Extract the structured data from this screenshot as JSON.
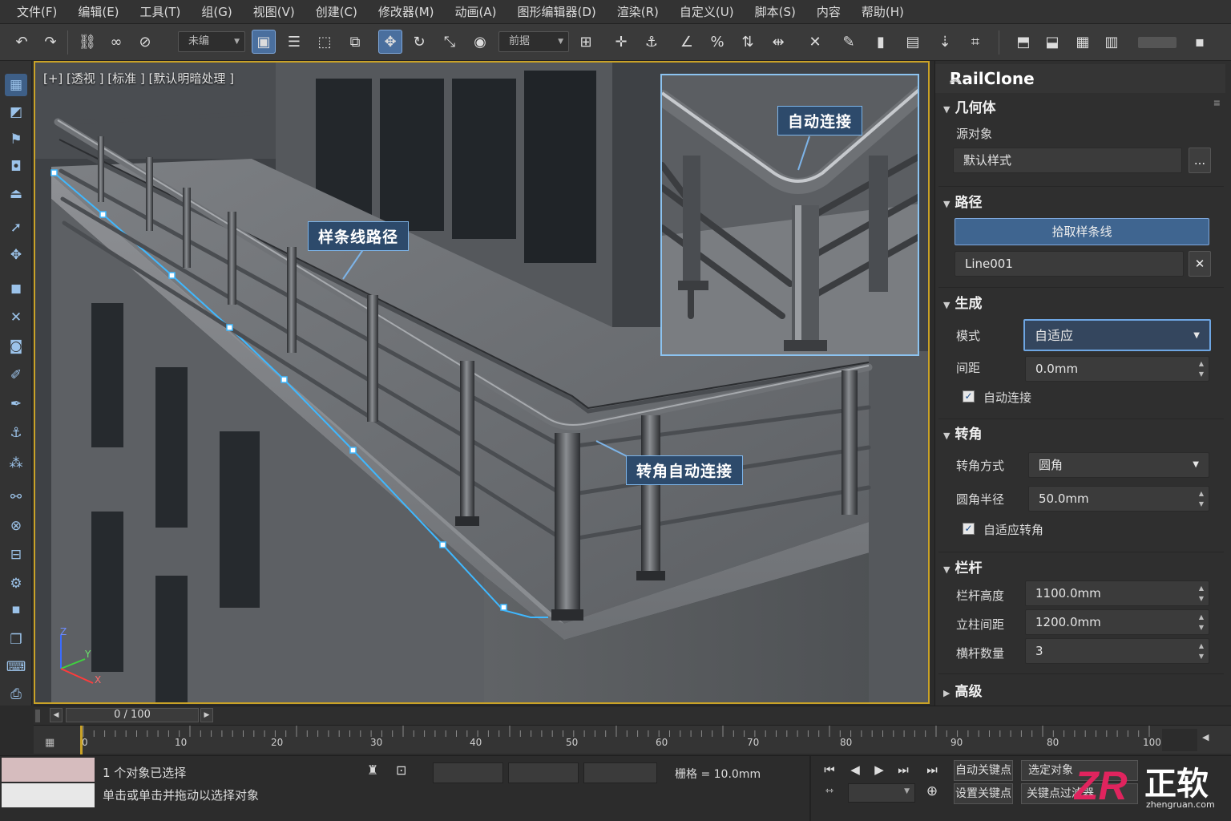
{
  "menu": [
    "文件(F)",
    "编辑(E)",
    "工具(T)",
    "组(G)",
    "视图(V)",
    "创建(C)",
    "修改器(M)",
    "动画(A)",
    "图形编辑器(D)",
    "渲染(R)",
    "自定义(U)",
    "脚本(S)",
    "内容",
    "帮助(H)"
  ],
  "toolbar": {
    "selection_set": "未编",
    "named_set": "前据"
  },
  "viewport": {
    "label": "[+] [透视 ] [标准 ] [默认明暗处理 ]",
    "callout_spline": "样条线路径",
    "callout_corner": "转角自动连接",
    "callout_auto": "自动连接",
    "axis_x": "X",
    "axis_y": "Y",
    "axis_z": "Z"
  },
  "panel": {
    "title": "RailClone",
    "geometry": {
      "head": "几何体",
      "source_label": "源对象",
      "source_value": "默认样式",
      "browse": "..."
    },
    "path": {
      "head": "路径",
      "pick_button": "拾取样条线",
      "spline_value": "Line001",
      "clear": "✕"
    },
    "generate": {
      "head": "生成",
      "mode_label": "模式",
      "mode_value": "自适应",
      "spacing_label": "间距",
      "spacing_value": "0.0mm",
      "auto_connect": "自动连接"
    },
    "corner": {
      "head": "转角",
      "type_label": "转角方式",
      "type_value": "圆角",
      "radius_label": "圆角半径",
      "radius_value": "50.0mm",
      "adaptive": "自适应转角"
    },
    "rail": {
      "head": "栏杆",
      "height_label": "栏杆高度",
      "height_value": "1100.0mm",
      "post_label": "立柱间距",
      "post_value": "1200.0mm",
      "count_label": "横杆数量",
      "count_value": "3"
    },
    "advanced": {
      "head": "高级"
    }
  },
  "timeline": {
    "frame": "0 / 100",
    "ticks": [
      "0",
      "10",
      "20",
      "30",
      "40",
      "50",
      "60",
      "70",
      "80",
      "90",
      "80",
      "100"
    ]
  },
  "status": {
    "selected": "1 个对象已选择",
    "prompt": "单击或单击并拖动以选择对象",
    "grid": "栅格 = 10.0mm",
    "auto_key": "自动关键点",
    "set_key": "设置关键点",
    "selected_obj": "选定对象",
    "key_filter": "关键点过滤器",
    "watermark_site": "zhengruan.com",
    "watermark_brand": "正软"
  },
  "colors": {
    "accent": "#4a6f9e",
    "spline": "#3fb8ff",
    "viewport_border": "#c9a227",
    "callout_bg": "#2d4a6b"
  }
}
